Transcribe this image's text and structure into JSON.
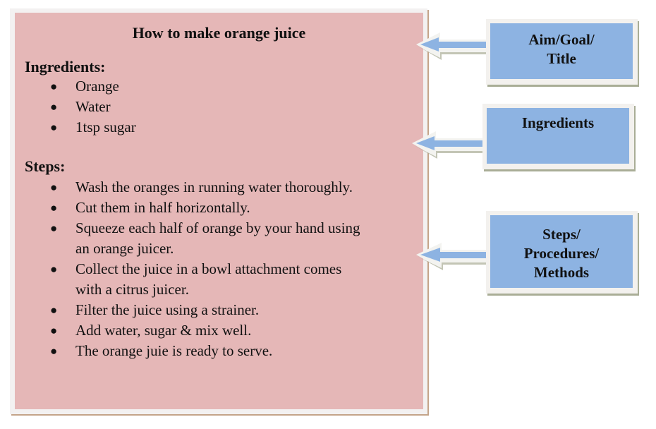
{
  "recipe": {
    "title": "How to make orange juice",
    "ingredients_heading": "Ingredients:",
    "ingredients": [
      "Orange",
      "Water",
      "1tsp sugar"
    ],
    "steps_heading": "Steps:",
    "steps": [
      [
        "Wash the oranges in running water thoroughly."
      ],
      [
        "Cut them in half horizontally."
      ],
      [
        "Squeeze each half of orange by your hand using",
        "an orange juicer."
      ],
      [
        "Collect the juice in a bowl attachment comes",
        "with a citrus juicer."
      ],
      [
        "Filter the juice using a strainer."
      ],
      [
        "Add water, sugar & mix well."
      ],
      [
        "The orange juie is ready to serve."
      ]
    ],
    "bullet_glyph": "●"
  },
  "labels": [
    {
      "id": "aim",
      "lines": [
        "Aim/Goal/",
        "Title"
      ],
      "points_to": "title"
    },
    {
      "id": "ingredients",
      "lines": [
        "Ingredients"
      ],
      "points_to": "ingredients"
    },
    {
      "id": "steps",
      "lines": [
        "Steps/",
        "Procedures/",
        "Methods"
      ],
      "points_to": "steps"
    }
  ],
  "colors": {
    "card_fill": "#e5b7b7",
    "label_fill": "#8db3e2",
    "arrow_fill": "#8db3e2"
  }
}
